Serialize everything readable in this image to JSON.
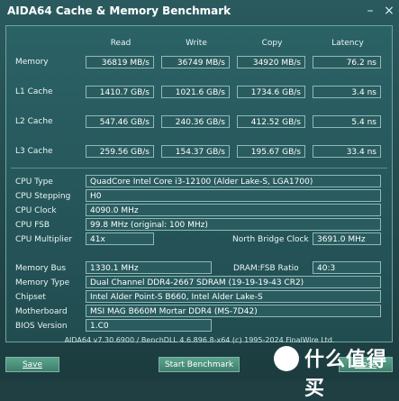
{
  "window": {
    "title": "AIDA64 Cache & Memory Benchmark"
  },
  "columns": [
    "Read",
    "Write",
    "Copy",
    "Latency"
  ],
  "rows": [
    {
      "label": "Memory",
      "read": "36819 MB/s",
      "write": "36749 MB/s",
      "copy": "34920 MB/s",
      "latency": "76.2 ns"
    },
    {
      "label": "L1 Cache",
      "read": "1410.7 GB/s",
      "write": "1021.6 GB/s",
      "copy": "1734.6 GB/s",
      "latency": "3.4 ns"
    },
    {
      "label": "L2 Cache",
      "read": "547.46 GB/s",
      "write": "240.36 GB/s",
      "copy": "412.52 GB/s",
      "latency": "5.4 ns"
    },
    {
      "label": "L3 Cache",
      "read": "259.56 GB/s",
      "write": "154.37 GB/s",
      "copy": "195.67 GB/s",
      "latency": "33.4 ns"
    }
  ],
  "cpu": {
    "type_label": "CPU Type",
    "type": "QuadCore Intel Core i3-12100  (Alder Lake-S, LGA1700)",
    "stepping_label": "CPU Stepping",
    "stepping": "H0",
    "clock_label": "CPU Clock",
    "clock": "4090.0 MHz",
    "fsb_label": "CPU FSB",
    "fsb": "99.8 MHz  (original: 100 MHz)",
    "mult_label": "CPU Multiplier",
    "mult": "41x",
    "nb_label": "North Bridge Clock",
    "nb": "3691.0 MHz"
  },
  "mem": {
    "bus_label": "Memory Bus",
    "bus": "1330.1 MHz",
    "ratio_label": "DRAM:FSB Ratio",
    "ratio": "40:3",
    "type_label": "Memory Type",
    "type": "Dual Channel DDR4-2667 SDRAM  (19-19-19-43 CR2)",
    "chipset_label": "Chipset",
    "chipset": "Intel Alder Point-S B660, Intel Alder Lake-S",
    "mobo_label": "Motherboard",
    "mobo": "MSI MAG B660M Mortar DDR4 (MS-7D42)",
    "bios_label": "BIOS Version",
    "bios": "1.C0"
  },
  "footer": "AIDA64 v7.30.6900 / BenchDLL 4.6.896.8-x64  (c) 1995-2024 FinalWire Ltd.",
  "buttons": {
    "save": "Save",
    "start": "Start Benchmark",
    "close": "Close"
  },
  "watermark": "什么值得买"
}
